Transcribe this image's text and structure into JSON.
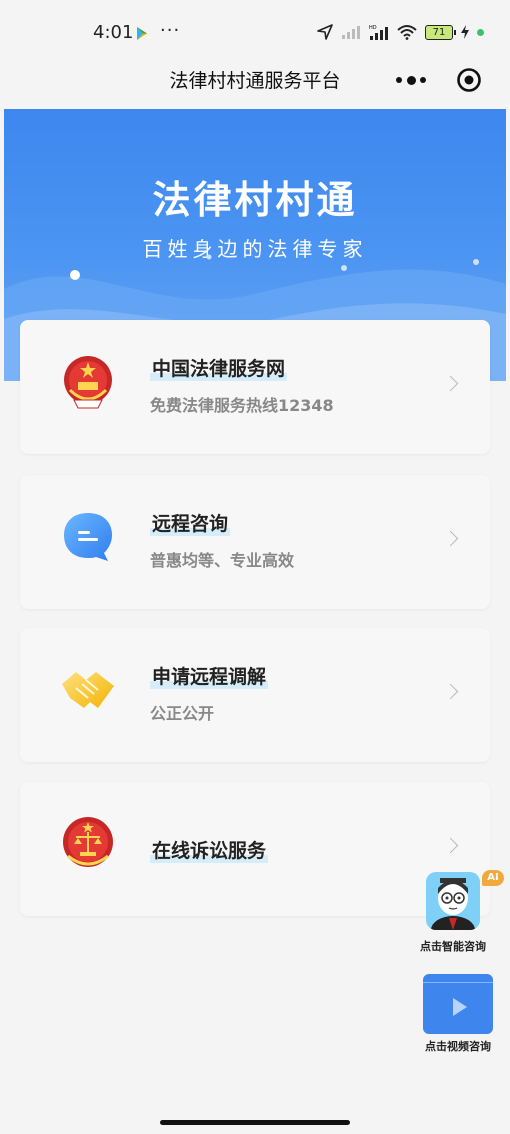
{
  "status_bar": {
    "time": "4:01",
    "more": "···",
    "battery": "71",
    "colors": {
      "battery_fill": "#c8e87a",
      "dot": "#39c46a"
    }
  },
  "nav": {
    "title": "法律村村通服务平台",
    "icons": [
      "more-icon",
      "record-icon"
    ]
  },
  "hero": {
    "title": "法律村村通",
    "subtitle": "百姓身边的法律专家",
    "colors": {
      "top": "#3d87ef",
      "bottom": "#6aa8f4"
    }
  },
  "cards": [
    {
      "title": "中国法律服务网",
      "subtitle": "免费法律服务热线12348",
      "icon": "national-emblem-icon"
    },
    {
      "title": "远程咨询",
      "subtitle": "普惠均等、专业高效",
      "icon": "chat-bubble-icon"
    },
    {
      "title": "申请远程调解",
      "subtitle": "公正公开",
      "icon": "handshake-icon"
    },
    {
      "title": "在线诉讼服务",
      "subtitle": "",
      "icon": "court-emblem-icon"
    }
  ],
  "floating": {
    "ai_badge": "AI",
    "ai_label": "点击智能咨询",
    "video_label": "点击视频咨询"
  }
}
